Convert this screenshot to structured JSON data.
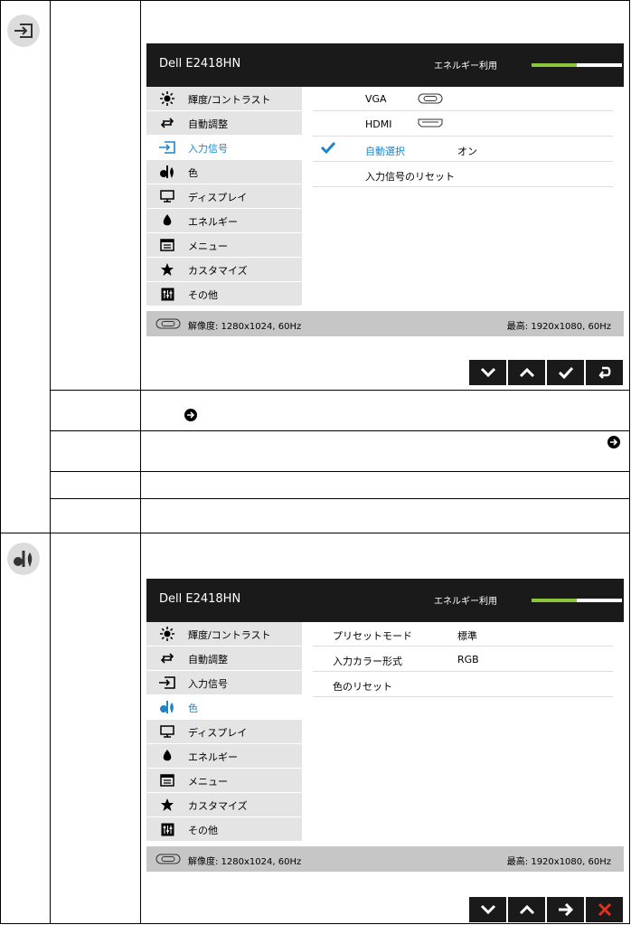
{
  "osd_top": {
    "model": "Dell E2418HN",
    "energy_label": "エネルギー利用",
    "energy_level": 0.5,
    "menu": [
      {
        "label": "輝度/コントラスト",
        "icon": "brightness-icon"
      },
      {
        "label": "自動調整",
        "icon": "auto-adjust-icon"
      },
      {
        "label": "入力信号",
        "icon": "input-source-icon"
      },
      {
        "label": "色",
        "icon": "color-icon"
      },
      {
        "label": "ディスプレイ",
        "icon": "display-icon"
      },
      {
        "label": "エネルギー",
        "icon": "energy-icon"
      },
      {
        "label": "メニュー",
        "icon": "menu-icon"
      },
      {
        "label": "カスタマイズ",
        "icon": "star-icon"
      },
      {
        "label": "その他",
        "icon": "others-icon"
      }
    ],
    "active_menu": 2,
    "submenu": [
      {
        "label": "VGA",
        "value": "",
        "icon": "vga-port-icon"
      },
      {
        "label": "HDMI",
        "value": "",
        "icon": "hdmi-port-icon"
      },
      {
        "label": "自動選択",
        "value": "オン",
        "checked": true
      },
      {
        "label": "入力信号のリセット",
        "value": ""
      }
    ],
    "resolution": "解像度: 1280x1024, 60Hz",
    "max_resolution": "最高: 1920x1080, 60Hz",
    "buttons": [
      "down-icon",
      "up-icon",
      "check-icon",
      "back-icon"
    ]
  },
  "osd_bottom": {
    "model": "Dell E2418HN",
    "energy_label": "エネルギー利用",
    "energy_level": 0.5,
    "menu": [
      {
        "label": "輝度/コントラスト",
        "icon": "brightness-icon"
      },
      {
        "label": "自動調整",
        "icon": "auto-adjust-icon"
      },
      {
        "label": "入力信号",
        "icon": "input-source-icon"
      },
      {
        "label": "色",
        "icon": "color-icon"
      },
      {
        "label": "ディスプレイ",
        "icon": "display-icon"
      },
      {
        "label": "エネルギー",
        "icon": "energy-icon"
      },
      {
        "label": "メニュー",
        "icon": "menu-icon"
      },
      {
        "label": "カスタマイズ",
        "icon": "star-icon"
      },
      {
        "label": "その他",
        "icon": "others-icon"
      }
    ],
    "active_menu": 3,
    "submenu": [
      {
        "label": "プリセットモード",
        "value": "標準"
      },
      {
        "label": "入力カラー形式",
        "value": "RGB"
      },
      {
        "label": "色のリセット",
        "value": ""
      }
    ],
    "resolution": "解像度: 1280x1024, 60Hz",
    "max_resolution": "最高: 1920x1080, 60Hz",
    "buttons": [
      "down-icon",
      "up-icon",
      "right-arrow-icon",
      "close-icon"
    ]
  },
  "colors": {
    "accent": "#1f84c6",
    "energy": "#8bc43f",
    "osd_dark": "#1a1a1a",
    "close_red": "#e0301e"
  }
}
